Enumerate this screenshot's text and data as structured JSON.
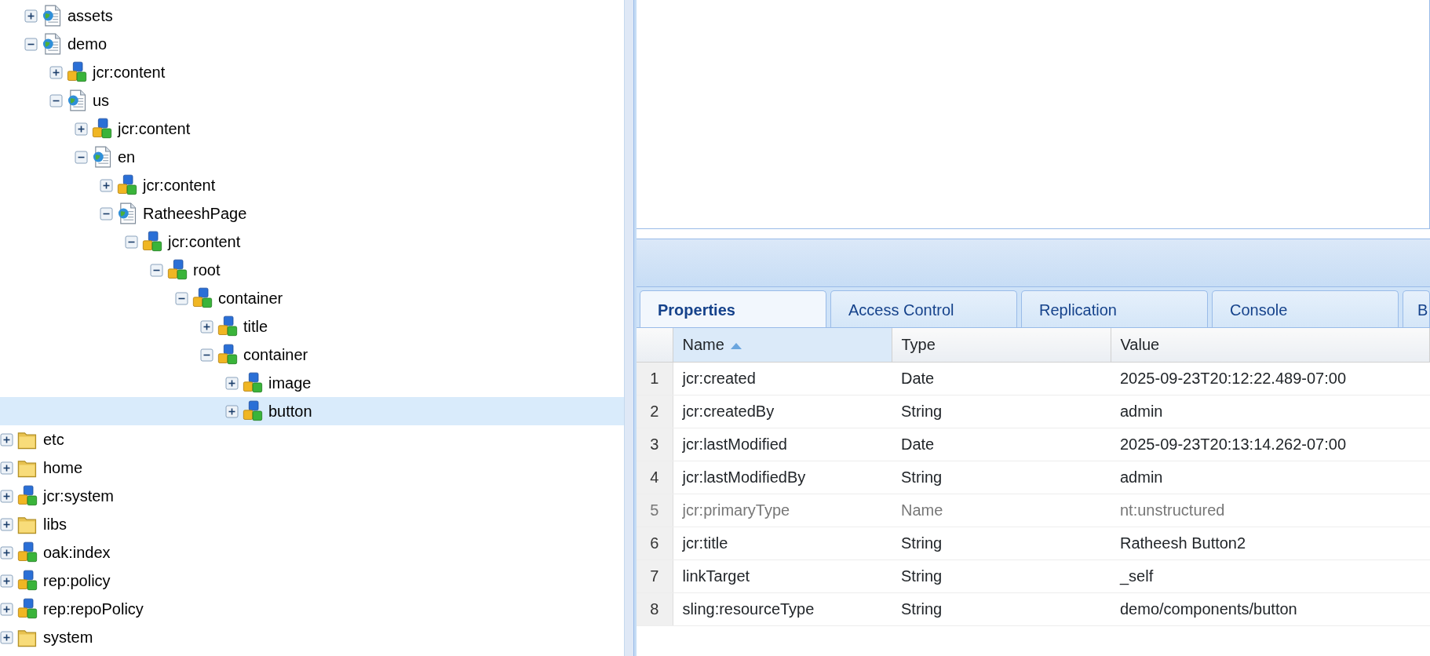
{
  "tree": [
    {
      "children": [
        {
          "label": "assets",
          "kind": "page",
          "expanded": false,
          "selected": false
        },
        {
          "label": "demo",
          "kind": "page",
          "expanded": true,
          "selected": false,
          "children": [
            {
              "label": "jcr:content",
              "kind": "node",
              "expanded": false,
              "selected": false
            },
            {
              "label": "us",
              "kind": "page",
              "expanded": true,
              "selected": false,
              "children": [
                {
                  "label": "jcr:content",
                  "kind": "node",
                  "expanded": false,
                  "selected": false
                },
                {
                  "label": "en",
                  "kind": "page",
                  "expanded": true,
                  "selected": false,
                  "children": [
                    {
                      "label": "jcr:content",
                      "kind": "node",
                      "expanded": false,
                      "selected": false
                    },
                    {
                      "label": "RatheeshPage",
                      "kind": "page",
                      "expanded": true,
                      "selected": false,
                      "children": [
                        {
                          "label": "jcr:content",
                          "kind": "node",
                          "expanded": true,
                          "selected": false,
                          "children": [
                            {
                              "label": "root",
                              "kind": "node",
                              "expanded": true,
                              "selected": false,
                              "children": [
                                {
                                  "label": "container",
                                  "kind": "node",
                                  "expanded": true,
                                  "selected": false,
                                  "children": [
                                    {
                                      "label": "title",
                                      "kind": "node",
                                      "expanded": false,
                                      "selected": false
                                    },
                                    {
                                      "label": "container",
                                      "kind": "node",
                                      "expanded": true,
                                      "selected": false,
                                      "children": [
                                        {
                                          "label": "image",
                                          "kind": "node",
                                          "expanded": false,
                                          "selected": false
                                        },
                                        {
                                          "label": "button",
                                          "kind": "node",
                                          "expanded": false,
                                          "selected": true
                                        }
                                      ]
                                    }
                                  ]
                                }
                              ]
                            }
                          ]
                        }
                      ]
                    }
                  ]
                }
              ]
            }
          ]
        }
      ]
    },
    {
      "label": "etc",
      "kind": "folder",
      "expanded": false,
      "selected": false
    },
    {
      "label": "home",
      "kind": "folder",
      "expanded": false,
      "selected": false
    },
    {
      "label": "jcr:system",
      "kind": "node",
      "expanded": false,
      "selected": false
    },
    {
      "label": "libs",
      "kind": "folder",
      "expanded": false,
      "selected": false
    },
    {
      "label": "oak:index",
      "kind": "node",
      "expanded": false,
      "selected": false
    },
    {
      "label": "rep:policy",
      "kind": "node",
      "expanded": false,
      "selected": false
    },
    {
      "label": "rep:repoPolicy",
      "kind": "node",
      "expanded": false,
      "selected": false
    },
    {
      "label": "system",
      "kind": "folder",
      "expanded": false,
      "selected": false
    }
  ],
  "tabs": [
    {
      "label": "Properties",
      "selected": true
    },
    {
      "label": "Access Control",
      "selected": false
    },
    {
      "label": "Replication",
      "selected": false
    },
    {
      "label": "Console",
      "selected": false
    },
    {
      "label": "B",
      "selected": false
    }
  ],
  "table": {
    "columns": [
      {
        "label": "Name",
        "sorted": true
      },
      {
        "label": "Type",
        "sorted": false
      },
      {
        "label": "Value",
        "sorted": false
      }
    ],
    "rows": [
      {
        "number": "1",
        "name": "jcr:created",
        "type": "Date",
        "value": "2025-09-23T20:12:22.489-07:00",
        "protected": false
      },
      {
        "number": "2",
        "name": "jcr:createdBy",
        "type": "String",
        "value": "admin",
        "protected": false
      },
      {
        "number": "3",
        "name": "jcr:lastModified",
        "type": "Date",
        "value": "2025-09-23T20:13:14.262-07:00",
        "protected": false
      },
      {
        "number": "4",
        "name": "jcr:lastModifiedBy",
        "type": "String",
        "value": "admin",
        "protected": false
      },
      {
        "number": "5",
        "name": "jcr:primaryType",
        "type": "Name",
        "value": "nt:unstructured",
        "protected": true
      },
      {
        "number": "6",
        "name": "jcr:title",
        "type": "String",
        "value": "Ratheesh Button2",
        "protected": false
      },
      {
        "number": "7",
        "name": "linkTarget",
        "type": "String",
        "value": "_self",
        "protected": false
      },
      {
        "number": "8",
        "name": "sling:resourceType",
        "type": "String",
        "value": "demo/components/button",
        "protected": false
      }
    ]
  }
}
